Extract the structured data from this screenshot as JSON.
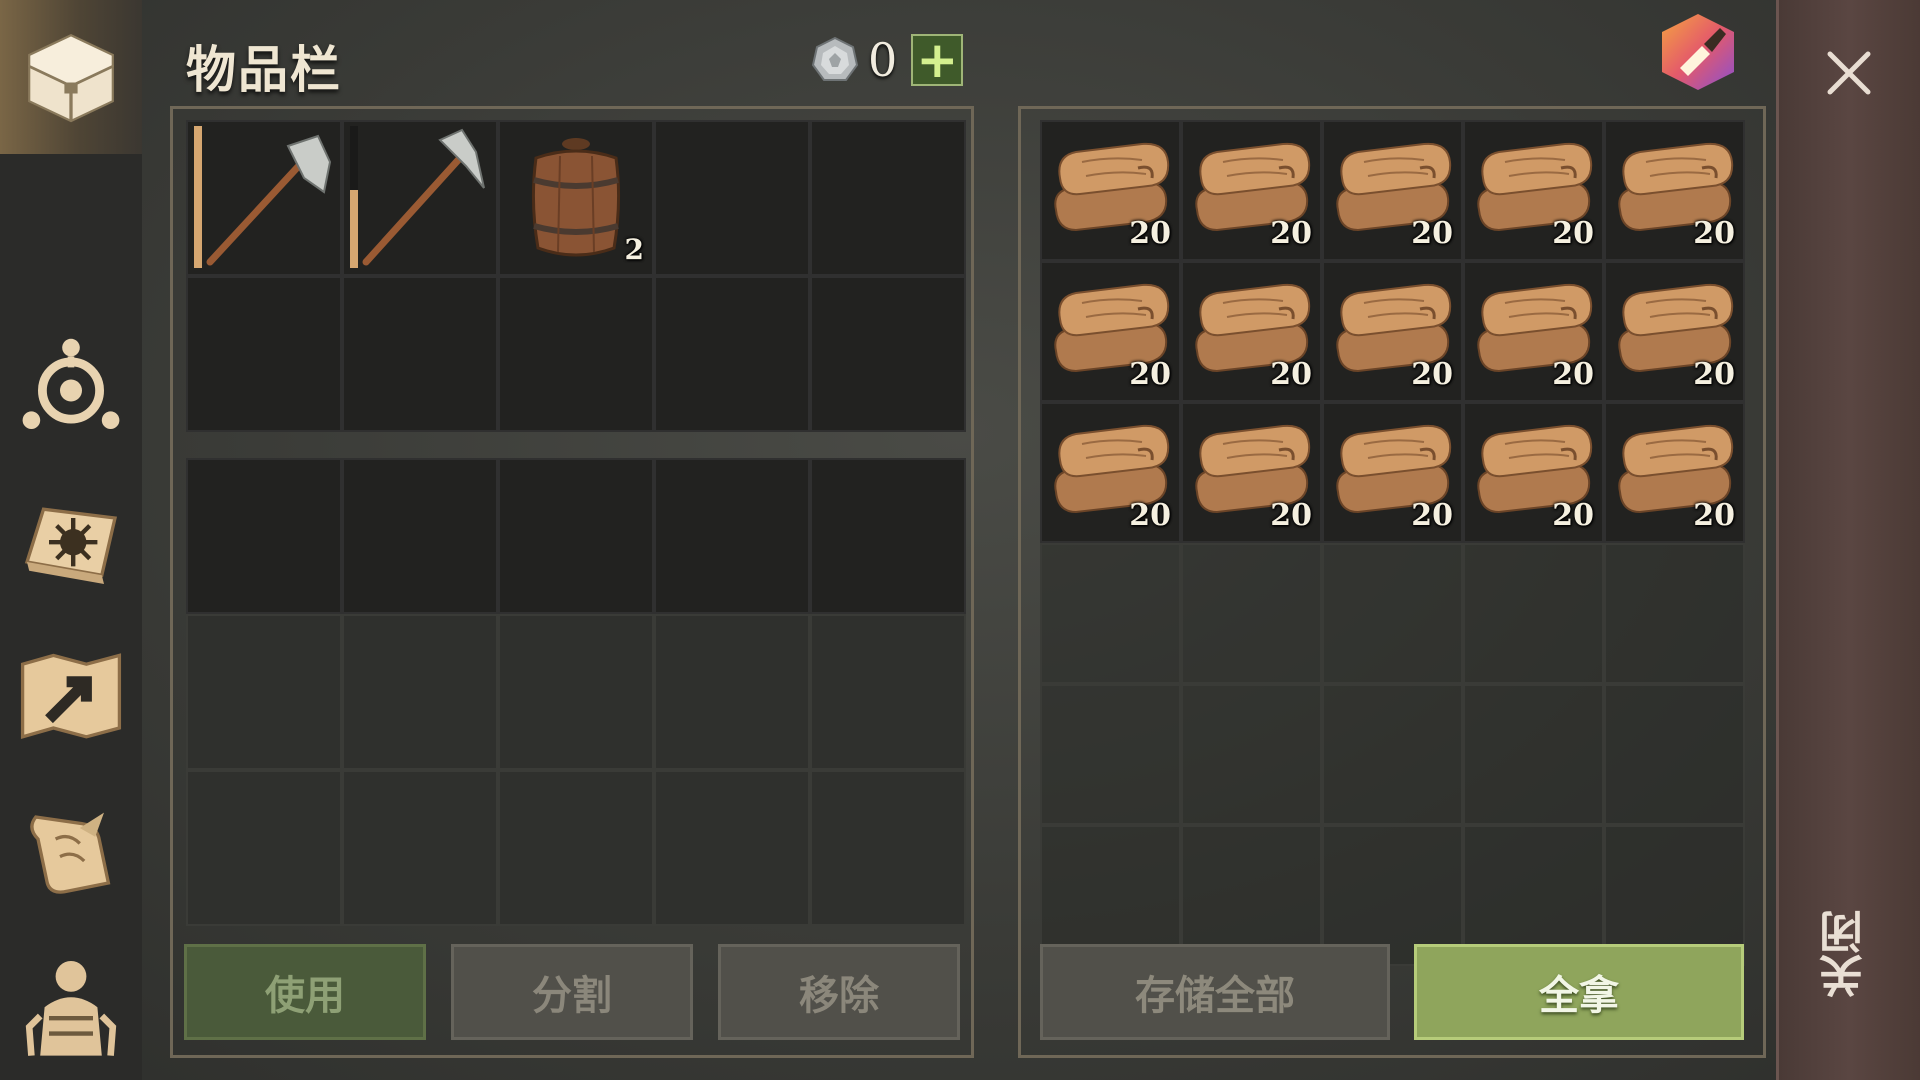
{
  "title": "物品栏",
  "currency": {
    "icon": "silver-coin-icon",
    "value": "0",
    "add_label": "+"
  },
  "sidebar": {
    "items": [
      {
        "name": "chest-icon",
        "active": true
      },
      {
        "name": "skills-icon"
      },
      {
        "name": "crafting-book-icon"
      },
      {
        "name": "map-icon"
      },
      {
        "name": "quest-scroll-icon"
      },
      {
        "name": "character-icon"
      }
    ]
  },
  "inventory": {
    "slots": [
      {
        "item": "stone-hatchet-icon",
        "qty": "",
        "durability": 1.0
      },
      {
        "item": "stone-pickaxe-icon",
        "qty": "",
        "durability": 0.55
      },
      {
        "item": "barrel-icon",
        "qty": "2"
      }
    ]
  },
  "storage": {
    "item": "cloth-icon",
    "slots": [
      "20",
      "20",
      "20",
      "20",
      "20",
      "20",
      "20",
      "20",
      "20",
      "20",
      "20",
      "20",
      "20",
      "20",
      "20"
    ]
  },
  "buttons": {
    "use": "使用",
    "split": "分割",
    "remove": "移除",
    "store_all": "存储全部",
    "take_all": "全拿"
  },
  "close_label": "关闭",
  "colors": {
    "accent_green": "#8fa55c",
    "panel_border": "#6f6757"
  }
}
